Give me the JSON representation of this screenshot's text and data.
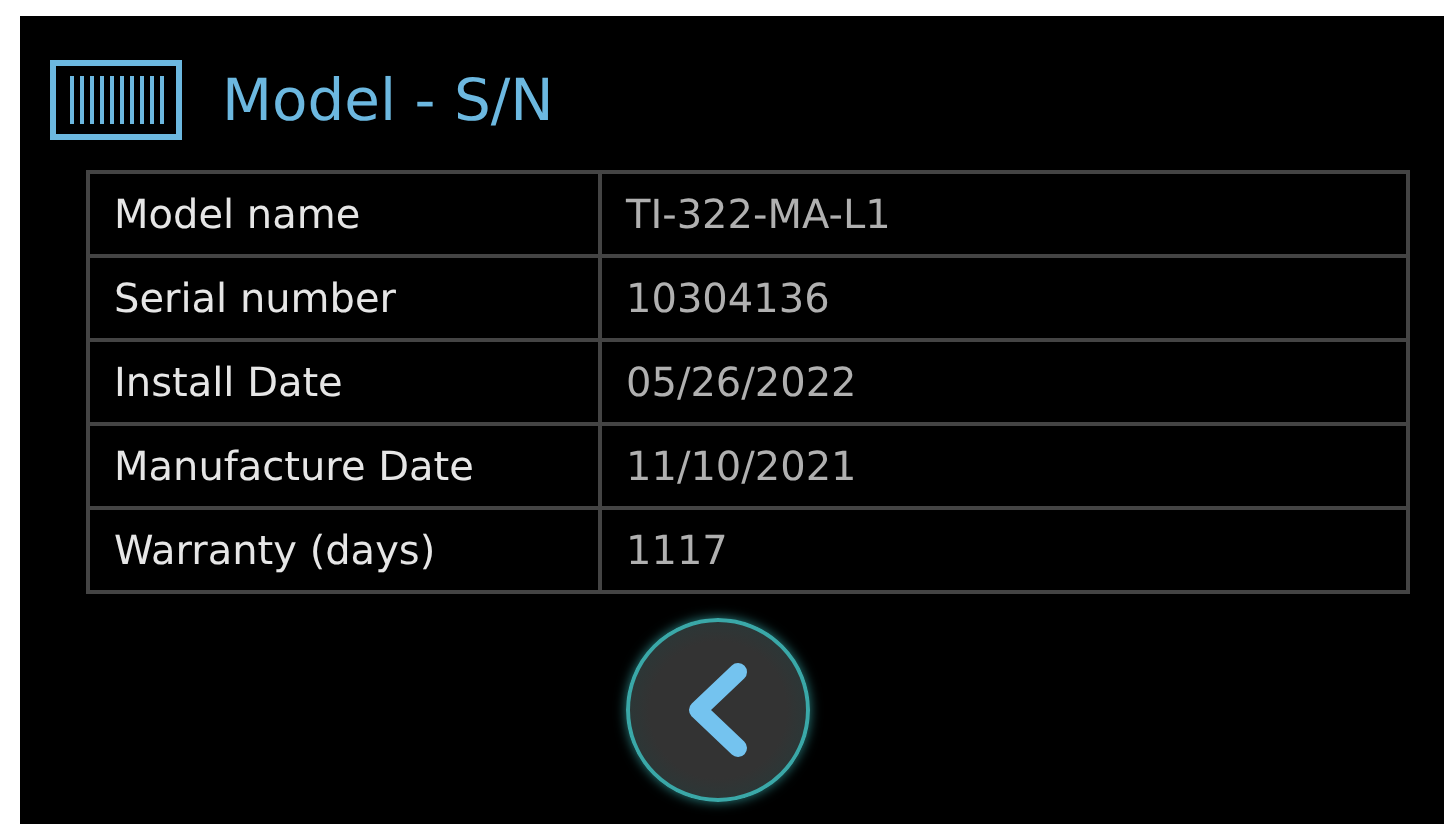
{
  "header": {
    "title": "Model - S/N"
  },
  "table": {
    "rows": [
      {
        "label": "Model name",
        "value": "TI-322-MA-L1"
      },
      {
        "label": "Serial number",
        "value": "10304136"
      },
      {
        "label": "Install Date",
        "value": "05/26/2022"
      },
      {
        "label": "Manufacture Date",
        "value": "11/10/2021"
      },
      {
        "label": "Warranty (days)",
        "value": "1117"
      }
    ]
  },
  "back_button": {
    "kind": "back"
  }
}
